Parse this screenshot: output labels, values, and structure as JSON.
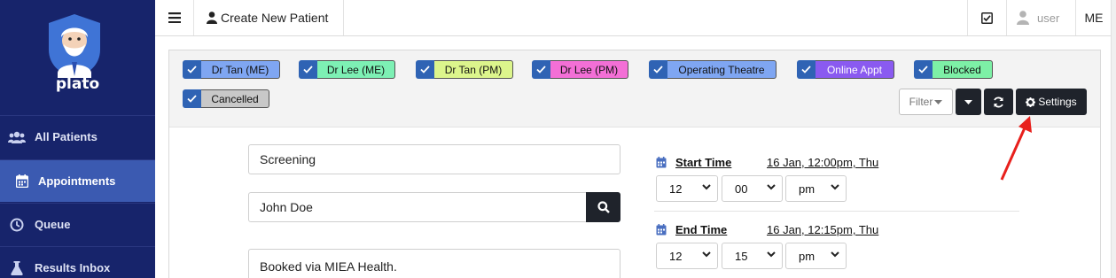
{
  "brand": {
    "name": "plato"
  },
  "sidebar": {
    "items": [
      {
        "label": "All Patients",
        "icon": "users-icon",
        "active": false
      },
      {
        "label": "Appointments",
        "icon": "calendar-icon",
        "active": true
      },
      {
        "label": "Queue",
        "icon": "clock-icon",
        "active": false
      },
      {
        "label": "Results Inbox",
        "icon": "flask-icon",
        "active": false
      }
    ]
  },
  "topbar": {
    "menu_icon": "hamburger-icon",
    "new_patient_label": "Create New Patient",
    "user_label": "user",
    "initials": "ME"
  },
  "calendars": [
    {
      "label": "Dr Tan (ME)",
      "color": "#7fa6f2",
      "checked": true
    },
    {
      "label": "Dr Lee (ME)",
      "color": "#7df0b4",
      "checked": true
    },
    {
      "label": "Dr Tan (PM)",
      "color": "#dcf58c",
      "checked": true
    },
    {
      "label": "Dr Lee (PM)",
      "color": "#f36fd6",
      "checked": true
    },
    {
      "label": "Operating Theatre",
      "color": "#7fa6f2",
      "checked": true
    },
    {
      "label": "Online Appt",
      "color": "#8a5af0",
      "checked": true
    },
    {
      "label": "Blocked",
      "color": "#7df0a6",
      "checked": true
    },
    {
      "label": "Cancelled",
      "color": "#c8c8c8",
      "checked": true
    }
  ],
  "toolbar": {
    "filter_label": "Filter",
    "settings_label": "Settings"
  },
  "form": {
    "title_value": "Screening",
    "patient_value": "John Doe",
    "notes_value": "Booked via MIEA Health.",
    "start": {
      "label": "Start Time",
      "summary": "16 Jan, 12:00pm, Thu",
      "hour": "12",
      "minute": "00",
      "ampm": "pm"
    },
    "end": {
      "label": "End Time",
      "summary": "16 Jan, 12:15pm, Thu",
      "hour": "12",
      "minute": "15",
      "ampm": "pm"
    }
  },
  "colors": {
    "sidebar_bg": "#17246b",
    "sidebar_active": "#3b5ab1",
    "dark_button": "#1f232b",
    "annotation_arrow": "#e8201c"
  }
}
